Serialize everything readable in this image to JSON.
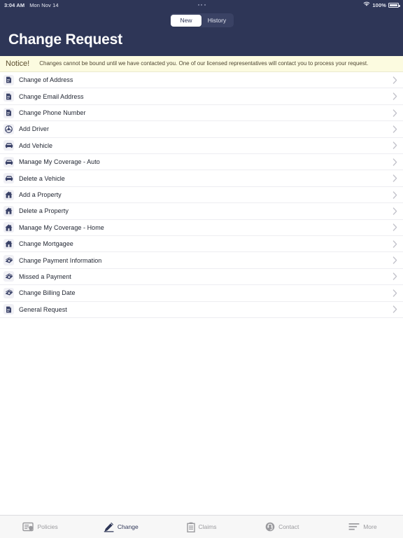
{
  "status_bar": {
    "time": "3:04 AM",
    "date": "Mon Nov 14",
    "battery_percent": "100%",
    "wifi_icon": "wifi-icon",
    "battery_icon": "battery-full-icon"
  },
  "header": {
    "title": "Change Request",
    "segmented_control": {
      "selected": "New",
      "options": [
        {
          "label": "New",
          "active": true
        },
        {
          "label": "History",
          "active": false
        }
      ]
    },
    "background_color": "#2e3657"
  },
  "notice": {
    "label": "Notice!",
    "text": "Changes cannot be bound until we have contacted you. One of our licensed representatives will contact you to process your request.",
    "background_color": "#fcfbe0"
  },
  "list": {
    "items": [
      {
        "label": "Change of Address",
        "icon": "document-icon"
      },
      {
        "label": "Change Email Address",
        "icon": "document-icon"
      },
      {
        "label": "Change Phone Number",
        "icon": "document-icon"
      },
      {
        "label": "Add Driver",
        "icon": "steering-wheel-icon"
      },
      {
        "label": "Add Vehicle",
        "icon": "car-icon"
      },
      {
        "label": "Manage My Coverage - Auto",
        "icon": "car-icon"
      },
      {
        "label": "Delete a Vehicle",
        "icon": "car-icon"
      },
      {
        "label": "Add a Property",
        "icon": "house-icon"
      },
      {
        "label": "Delete a Property",
        "icon": "house-icon"
      },
      {
        "label": "Manage My Coverage - Home",
        "icon": "house-icon"
      },
      {
        "label": "Change Mortgagee",
        "icon": "house-icon"
      },
      {
        "label": "Change Payment Information",
        "icon": "money-icon"
      },
      {
        "label": "Missed a Payment",
        "icon": "money-icon"
      },
      {
        "label": "Change Billing Date",
        "icon": "money-icon"
      },
      {
        "label": "General Request",
        "icon": "document-icon"
      }
    ],
    "chevron_icon": "chevron-right-icon"
  },
  "tabbar": {
    "tabs": [
      {
        "label": "Policies",
        "icon": "policy-certificate-icon",
        "active": false
      },
      {
        "label": "Change",
        "icon": "pencil-icon",
        "active": true
      },
      {
        "label": "Claims",
        "icon": "clipboard-icon",
        "active": false
      },
      {
        "label": "Contact",
        "icon": "headset-icon",
        "active": false
      },
      {
        "label": "More",
        "icon": "menu-lines-icon",
        "active": false
      }
    ],
    "active_color": "#2e3657",
    "inactive_color": "#9a9a9e"
  }
}
